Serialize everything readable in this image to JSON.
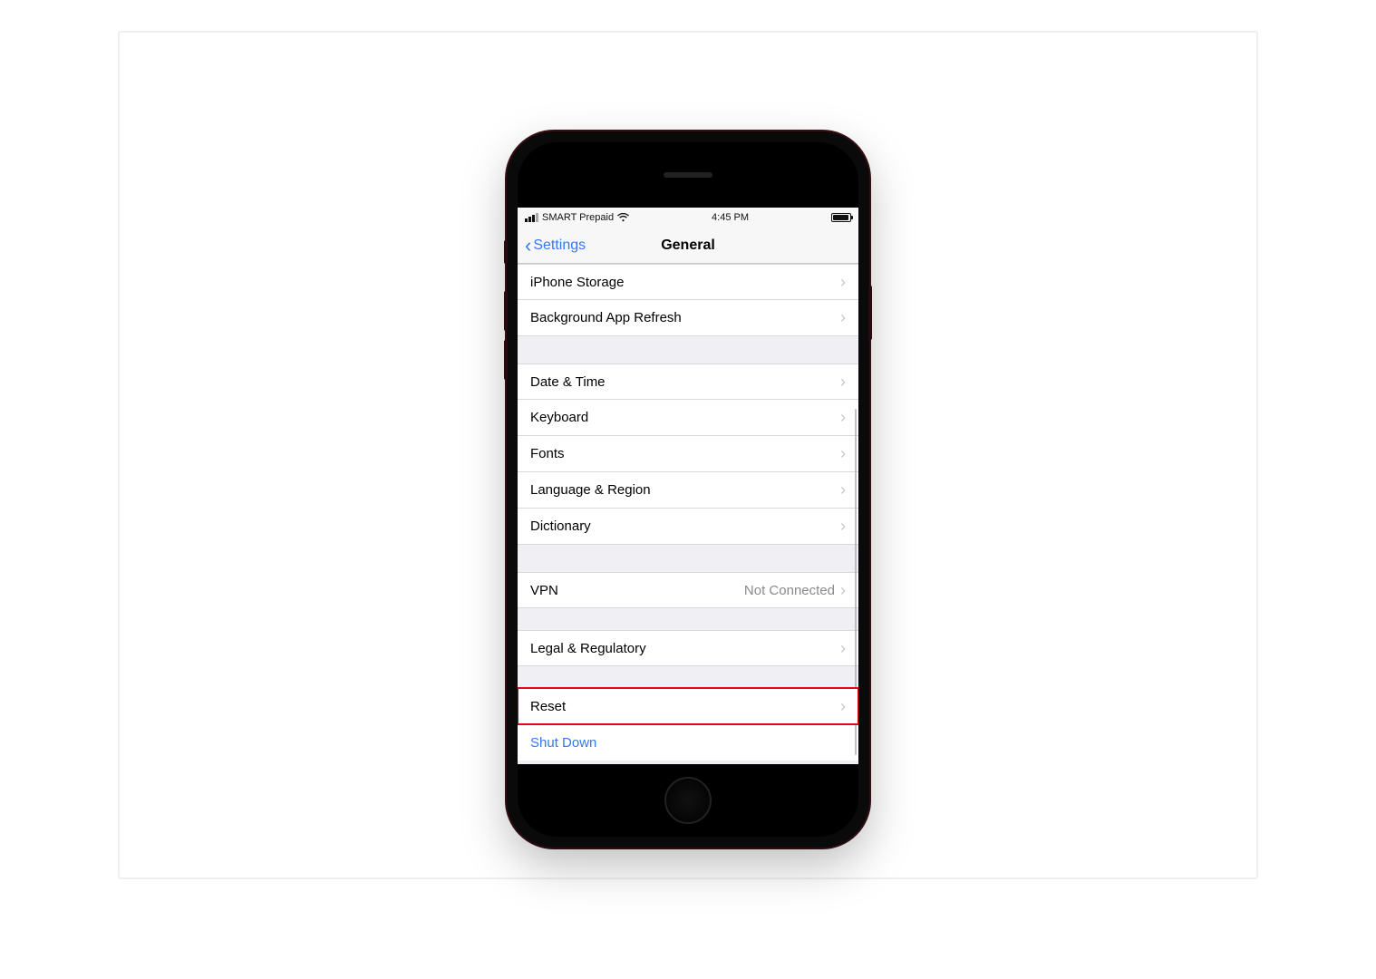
{
  "status_bar": {
    "carrier": "SMART Prepaid",
    "time": "4:45 PM"
  },
  "nav": {
    "back_label": "Settings",
    "title": "General"
  },
  "groups": [
    {
      "gap_before": false,
      "rows": [
        {
          "label": "iPhone Storage"
        },
        {
          "label": "Background App Refresh"
        }
      ]
    },
    {
      "gap_before": true,
      "rows": [
        {
          "label": "Date & Time"
        },
        {
          "label": "Keyboard"
        },
        {
          "label": "Fonts"
        },
        {
          "label": "Language & Region"
        },
        {
          "label": "Dictionary"
        }
      ]
    },
    {
      "gap_before": true,
      "rows": [
        {
          "label": "VPN",
          "detail": "Not Connected"
        }
      ]
    },
    {
      "gap_before": true,
      "rows": [
        {
          "label": "Legal & Regulatory"
        }
      ]
    },
    {
      "gap_before": true,
      "rows": [
        {
          "label": "Reset",
          "highlighted": true
        },
        {
          "label": "Shut Down",
          "blue": true,
          "partial": true
        }
      ]
    }
  ]
}
